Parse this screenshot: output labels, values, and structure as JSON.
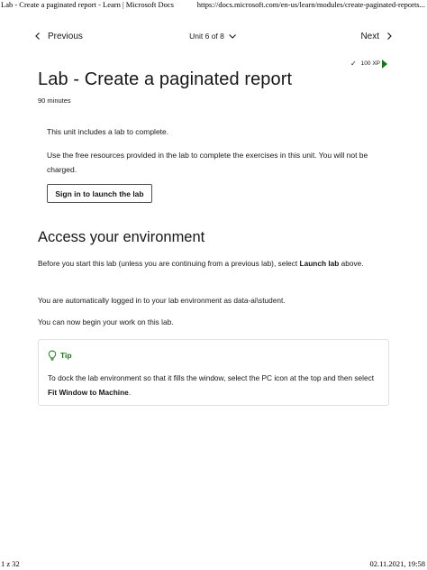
{
  "print_header": {
    "title": "Lab - Create a paginated report - Learn | Microsoft Docs",
    "url": "https://docs.microsoft.com/en-us/learn/modules/create-paginated-reports..."
  },
  "print_footer": {
    "page": "1 z 32",
    "datetime": "02.11.2021, 19:58"
  },
  "unit_nav": {
    "previous_label": "Previous",
    "unit_label": "Unit 6 of 8",
    "next_label": "Next"
  },
  "xp": {
    "label": "100 XP",
    "check": "✓",
    "accent_color": "#107c10"
  },
  "page": {
    "title": "Lab - Create a paginated report",
    "duration": "90 minutes"
  },
  "lab_box": {
    "intro": "This unit includes a lab to complete.",
    "description": "Use the free resources provided in the lab to complete the exercises in this unit. You will not be charged.",
    "button_label": "Sign in to launch the lab"
  },
  "section": {
    "title": "Access your environment",
    "p1_before": "Before you start this lab (unless you are continuing from a previous lab), select ",
    "p1_bold": "Launch lab",
    "p1_after": " above.",
    "p2": "You are automatically logged in to your lab environment as data-ai\\student.",
    "p3": "You can now begin your work on this lab."
  },
  "tip": {
    "label": "Tip",
    "icon": "lightbulb-icon",
    "body_before": "To dock the lab environment so that it fills the window, select the PC icon at the top and then select ",
    "body_bold": "Fit Window to Machine",
    "body_after": "."
  }
}
